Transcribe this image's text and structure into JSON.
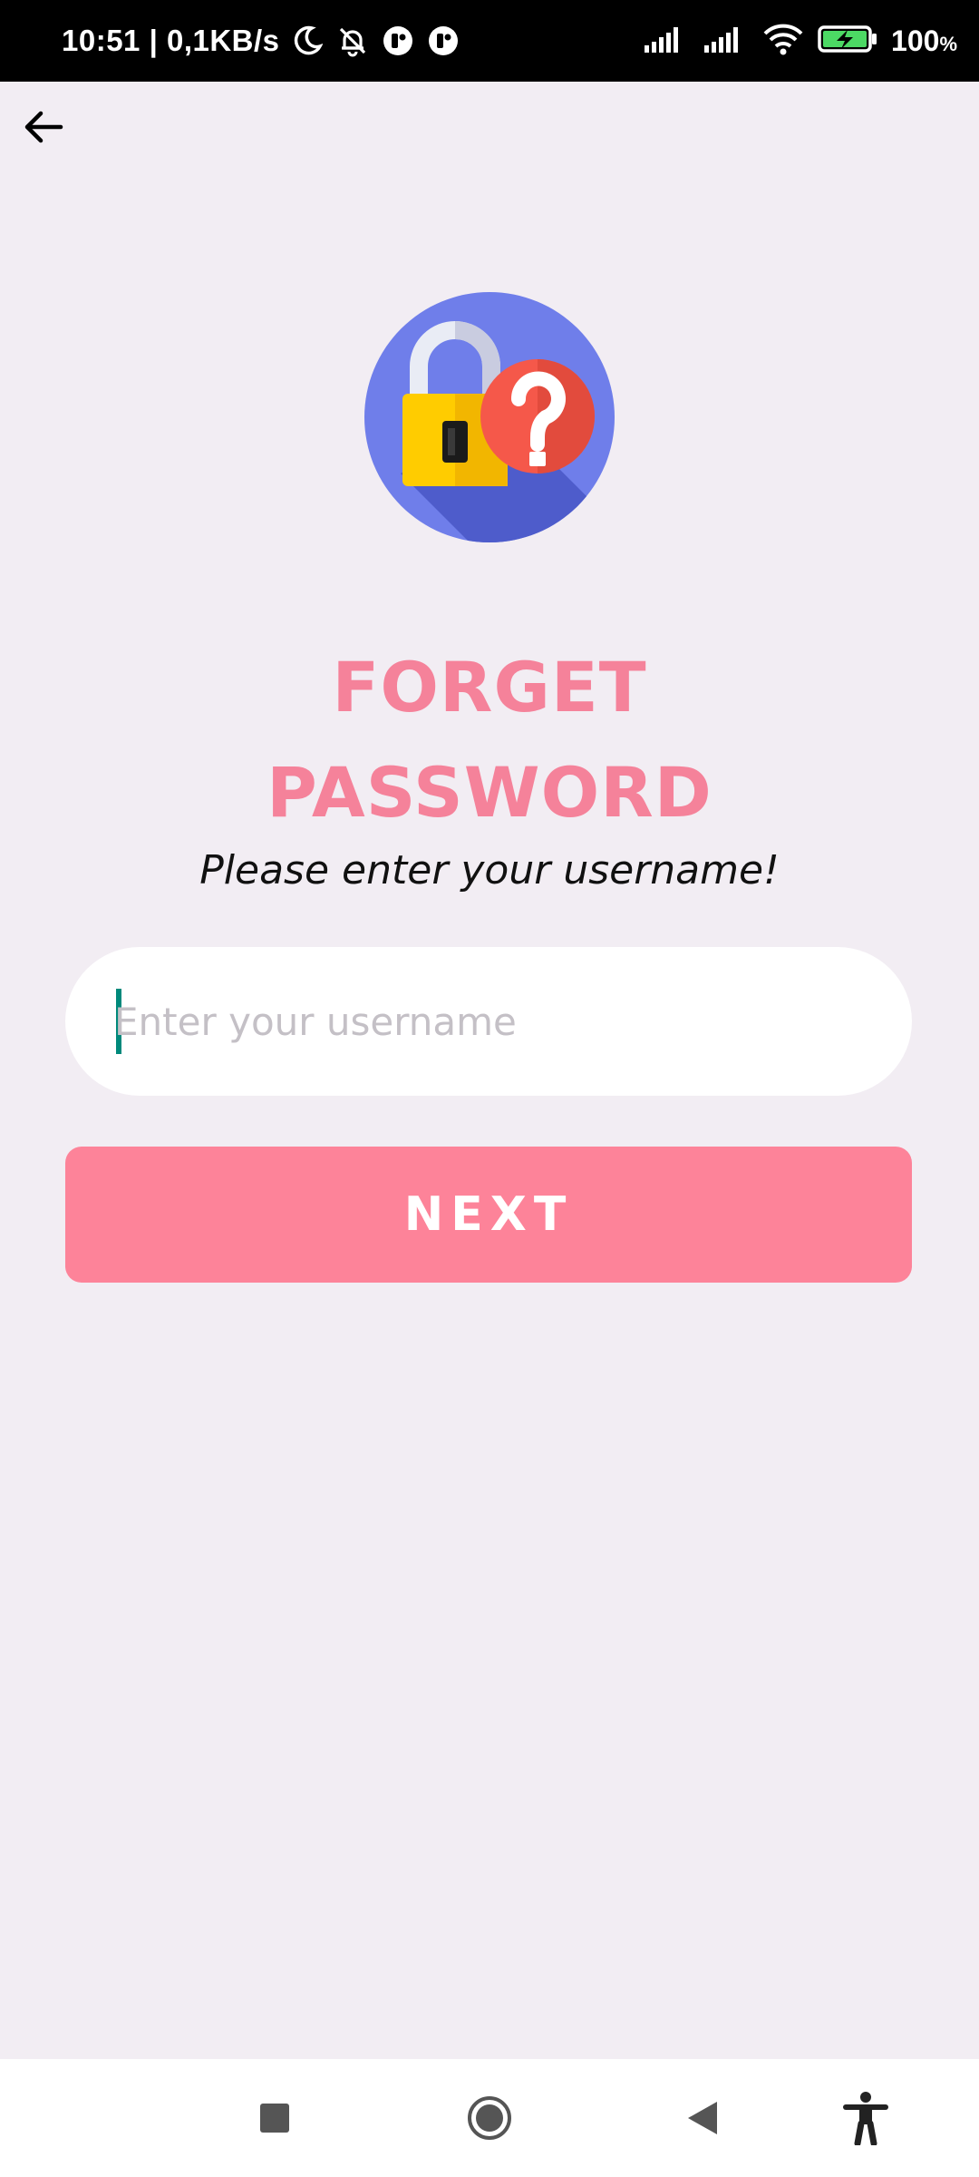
{
  "status_bar": {
    "time_and_speed": "10:51 | 0,1KB/s",
    "battery_percent": "100",
    "battery_unit": "%",
    "icons": [
      "moon-icon",
      "bell-off-icon",
      "app-notification-icon",
      "app-notification-icon",
      "signal-icon",
      "signal-icon",
      "wifi-icon",
      "battery-charging-icon"
    ]
  },
  "header": {
    "back_icon": "arrow-left-icon"
  },
  "hero": {
    "icon": "lock-question-icon",
    "colors": {
      "circle": "#6F7EEA",
      "lock": "#FFCC00",
      "question": "#F5584A"
    }
  },
  "title": {
    "line1": "FORGET",
    "line2": "PASSWORD"
  },
  "subtitle": "Please enter your username!",
  "form": {
    "username": {
      "value": "",
      "placeholder": "Enter your username"
    },
    "next_label": "NEXT"
  },
  "nav": {
    "icons": [
      "recents-square-icon",
      "home-circle-icon",
      "back-triangle-icon",
      "accessibility-icon"
    ]
  },
  "colors": {
    "background": "#F2EDF3",
    "accent": "#FD8399",
    "title": "#F5829A",
    "caret": "#00897B"
  }
}
